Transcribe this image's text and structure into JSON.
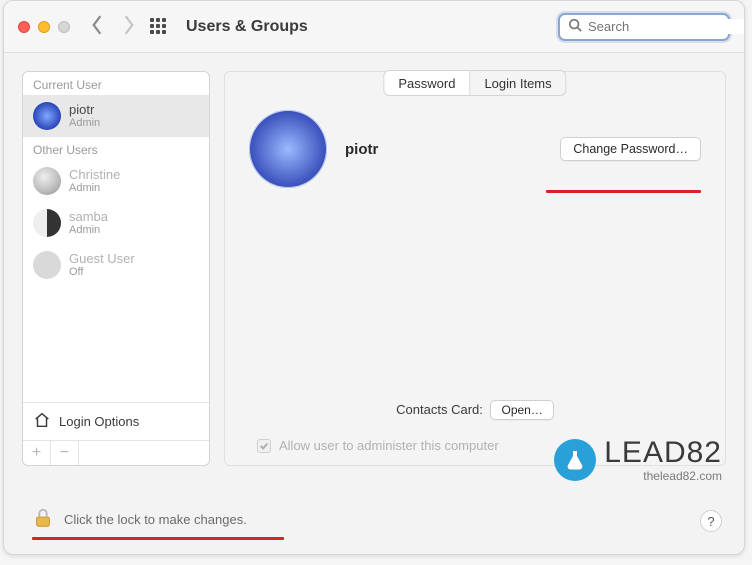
{
  "window": {
    "title": "Users & Groups",
    "search_placeholder": "Search"
  },
  "sidebar": {
    "current_label": "Current User",
    "other_label": "Other Users",
    "users": [
      {
        "name": "piotr",
        "role": "Admin",
        "avatar": "snow",
        "current": true,
        "selected": true
      },
      {
        "name": "Christine",
        "role": "Admin",
        "avatar": "eagle",
        "current": false,
        "selected": false
      },
      {
        "name": "samba",
        "role": "Admin",
        "avatar": "yin",
        "current": false,
        "selected": false
      },
      {
        "name": "Guest User",
        "role": "Off",
        "avatar": "guest",
        "current": false,
        "selected": false
      }
    ],
    "login_options": "Login Options",
    "plus": "+",
    "minus": "−"
  },
  "tabs": {
    "password": "Password",
    "login_items": "Login Items",
    "active": "password"
  },
  "main": {
    "profile_name": "piotr",
    "change_password": "Change Password…",
    "contacts_label": "Contacts Card:",
    "contacts_button": "Open…",
    "admin_checkbox_label": "Allow user to administer this computer",
    "admin_checked": true
  },
  "lock": {
    "text": "Click the lock to make changes.",
    "help": "?"
  },
  "watermark": {
    "brand": "LEAD82",
    "url": "thelead82.com"
  }
}
